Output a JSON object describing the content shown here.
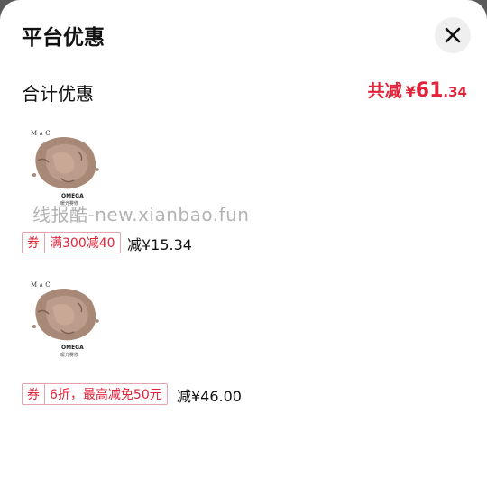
{
  "header": {
    "title": "平台优惠"
  },
  "summary": {
    "label": "合计优惠",
    "prefix": "共减",
    "currency": "¥",
    "amount_int": "61",
    "amount_dec": ".34"
  },
  "items": [
    {
      "brand": "M∧C",
      "product_name": "OMEGA",
      "product_sub": "暖光雾修",
      "coupon_tag": "券",
      "coupon_text": "满300减40",
      "saving": "减¥15.34"
    },
    {
      "brand": "M∧C",
      "product_name": "OMEGA",
      "product_sub": "暖光雾修",
      "coupon_tag": "券",
      "coupon_text": "6折，最高减免50元",
      "saving": "减¥46.00"
    }
  ],
  "watermark": "线报酷-new.xianbao.fun",
  "colors": {
    "accent": "#e2233a",
    "coupon_border": "#e8a3ad",
    "close_bg": "#efefef"
  },
  "icons": {
    "close": "close-icon"
  }
}
